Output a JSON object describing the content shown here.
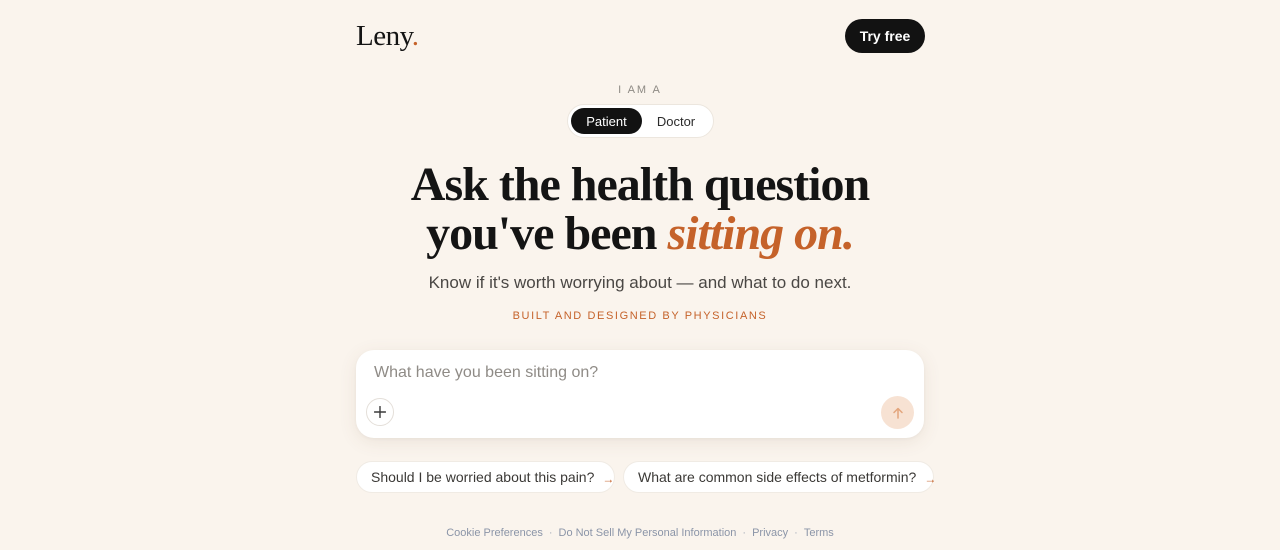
{
  "brand": {
    "name": "Leny",
    "dot": "."
  },
  "header": {
    "cta_label": "Try free"
  },
  "role_switch": {
    "label": "I AM A",
    "options": [
      "Patient",
      "Doctor"
    ],
    "selected": "Patient"
  },
  "hero": {
    "headline_line1": "Ask the health question",
    "headline_line2_plain": "you've been ",
    "headline_line2_accent": "sitting on.",
    "subhead": "Know if it's worth worrying about — and what to do next.",
    "tagline": "BUILT AND DESIGNED BY PHYSICIANS"
  },
  "composer": {
    "placeholder": "What have you been sitting on?",
    "value": "",
    "attach_icon": "plus-icon",
    "send_icon": "arrow-up-icon"
  },
  "suggestions": [
    {
      "text": "Should I be worried about this pain?",
      "arrow": "→"
    },
    {
      "text": "What are common side effects of metformin?",
      "arrow": "→"
    }
  ],
  "footer": {
    "links": [
      "Cookie Preferences",
      "Do Not Sell My Personal Information",
      "Privacy",
      "Terms"
    ],
    "separator": "·"
  },
  "colors": {
    "background": "#faf4ed",
    "accent": "#c5622a",
    "dark": "#121212",
    "send_button": "#f7e2d3"
  }
}
